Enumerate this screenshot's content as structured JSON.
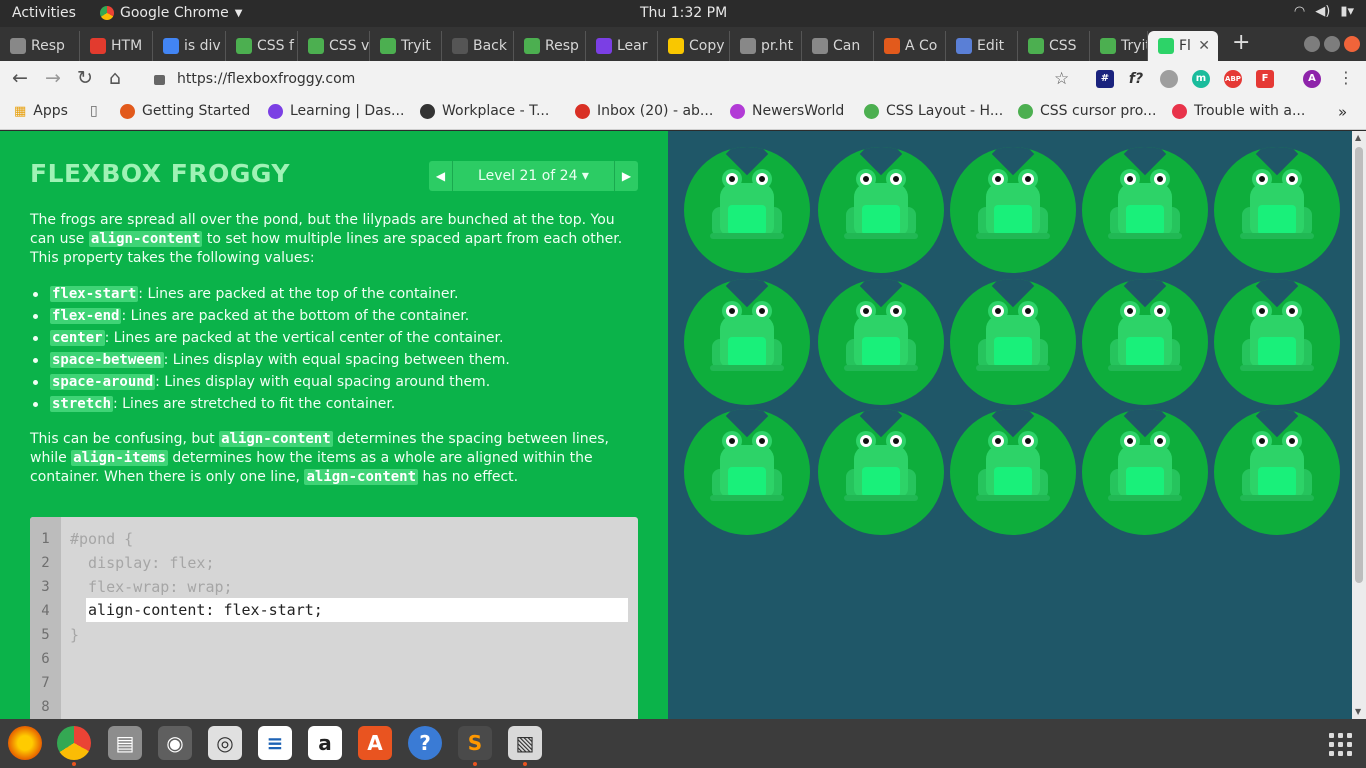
{
  "os_bar": {
    "activities": "Activities",
    "app_name": "Google Chrome",
    "clock": "Thu  1:32 PM"
  },
  "tabs": [
    {
      "label": "Resp",
      "color": "#888888"
    },
    {
      "label": "HTM",
      "color": "#e23b2e"
    },
    {
      "label": "is div",
      "color": "#4285f4"
    },
    {
      "label": "CSS f",
      "color": "#4caf50"
    },
    {
      "label": "CSS v",
      "color": "#4caf50"
    },
    {
      "label": "Tryit",
      "color": "#4caf50"
    },
    {
      "label": "Back",
      "color": "#555555"
    },
    {
      "label": "Resp",
      "color": "#4caf50"
    },
    {
      "label": "Lear",
      "color": "#7b3fe4"
    },
    {
      "label": "Copy",
      "color": "#f9c700"
    },
    {
      "label": "pr.ht",
      "color": "#888888"
    },
    {
      "label": "Can",
      "color": "#888888"
    },
    {
      "label": "A Co",
      "color": "#e25a1c"
    },
    {
      "label": "Edit",
      "color": "#5a7fd6"
    },
    {
      "label": "CSS",
      "color": "#4caf50"
    },
    {
      "label": "Tryit",
      "color": "#4caf50"
    },
    {
      "label": "Fl",
      "color": "#2dd368"
    }
  ],
  "address": {
    "url": "https://flexboxfroggy.com"
  },
  "bookmarks": [
    {
      "label": "Apps",
      "color": "#e8a10f"
    },
    {
      "label": "Getting Started",
      "color": "#e25a1c"
    },
    {
      "label": "Learning | Das...",
      "color": "#7b3fe4"
    },
    {
      "label": "Workplace - T...",
      "color": "#333333"
    },
    {
      "label": "Inbox (20) - ab...",
      "color": "#d93025"
    },
    {
      "label": "NewersWorld",
      "color": "#b23bd6"
    },
    {
      "label": "CSS Layout - H...",
      "color": "#4caf50"
    },
    {
      "label": "CSS cursor pro...",
      "color": "#4caf50"
    },
    {
      "label": "Trouble with a...",
      "color": "#e8334a"
    }
  ],
  "game": {
    "title": "FLEXBOX FROGGY",
    "level_label": "Level 21 of 24 ▾",
    "intro_1": "The frogs are spread all over the pond, but the lilypads are bunched at the top. You can use",
    "intro_code": "align-content",
    "intro_2": "to set how multiple lines are spaced apart from each other. This property takes the following values:",
    "values": [
      {
        "code": "flex-start",
        "desc": ": Lines are packed at the top of the container."
      },
      {
        "code": "flex-end",
        "desc": ": Lines are packed at the bottom of the container."
      },
      {
        "code": "center",
        "desc": ": Lines are packed at the vertical center of the container."
      },
      {
        "code": "space-between",
        "desc": ": Lines display with equal spacing between them."
      },
      {
        "code": "space-around",
        "desc": ": Lines display with equal spacing around them."
      },
      {
        "code": "stretch",
        "desc": ": Lines are stretched to fit the container."
      }
    ],
    "note_1": "This can be confusing, but",
    "note_code_1": "align-content",
    "note_2": "determines the spacing between lines, while",
    "note_code_2": "align-items",
    "note_3": "determines how the items as a whole are aligned within the container. When there is only one line,",
    "note_code_3": "align-content",
    "note_4": "has no effect."
  },
  "editor": {
    "line_numbers": [
      "1",
      "2",
      "3",
      "4",
      "5",
      "6",
      "7",
      "8"
    ],
    "line1": "#pond {",
    "line2": "  display: flex;",
    "line3": "  flex-wrap: wrap;",
    "input_value": "align-content: flex-start;",
    "line5": "}"
  },
  "colors": {
    "sidebar": "#0bb34a",
    "pond": "#1f5768",
    "lily": "#0eae3c",
    "frog": "#2dd368"
  }
}
